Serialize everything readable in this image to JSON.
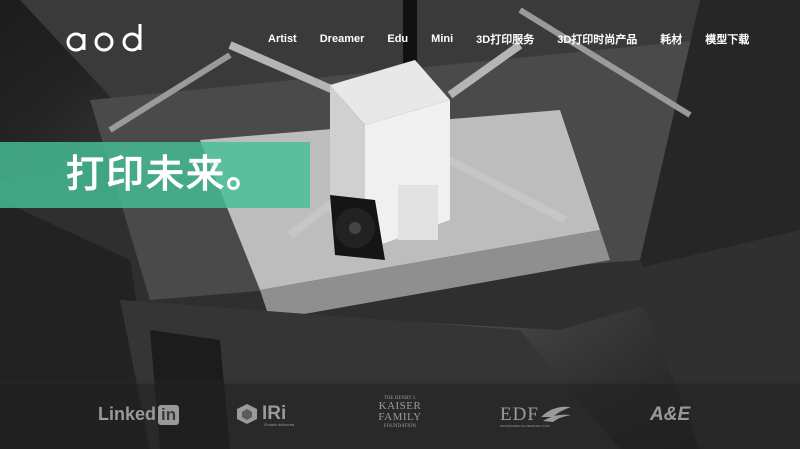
{
  "nav": {
    "logo_text": "aod",
    "items": [
      {
        "label": "Artist"
      },
      {
        "label": "Dreamer"
      },
      {
        "label": "Edu"
      },
      {
        "label": "Mini"
      },
      {
        "label": "3D打印服务"
      },
      {
        "label": "3D打印时尚产品"
      },
      {
        "label": "耗材"
      },
      {
        "label": "模型下载"
      }
    ]
  },
  "hero": {
    "headline": "打印未来。",
    "banner_color": "#46be96"
  },
  "partners": {
    "linkedin": {
      "text": "Linked",
      "box": "in"
    },
    "iri": {
      "name": "IRi",
      "tagline": "Growth delivered"
    },
    "kaiser": {
      "top": "THE HENRY J.",
      "line1": "KAISER",
      "line2": "FAMILY",
      "bottom": "FOUNDATION"
    },
    "edf": {
      "name": "EDF",
      "sub": "ENVIRONMENTAL DEFENSE FUND"
    },
    "ae": {
      "name": "A&E"
    }
  }
}
